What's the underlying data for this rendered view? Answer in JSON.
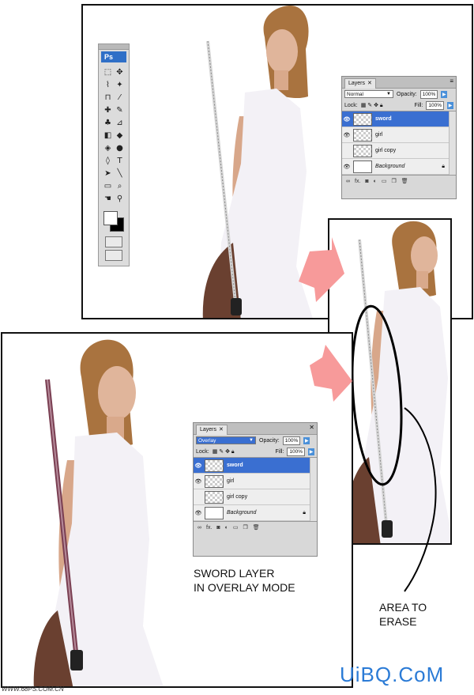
{
  "toolbox": {
    "logo": "Ps",
    "tools": [
      "⬚",
      "✥",
      "⌇",
      "✦",
      "⊓",
      "⁄",
      "✚",
      "✎",
      "♣",
      "⊿",
      "◧",
      "◆",
      "◈",
      "●",
      "◊",
      "T",
      "➤",
      "╲",
      "▭",
      "⌕",
      "☚",
      "⚲"
    ]
  },
  "layers_top": {
    "tab": "Layers",
    "blend_mode": "Normal",
    "opacity_label": "Opacity:",
    "opacity": "100%",
    "lock_label": "Lock:",
    "fill_label": "Fill:",
    "fill": "100%",
    "layers": [
      {
        "name": "sword",
        "selected": true
      },
      {
        "name": "girl",
        "selected": false
      },
      {
        "name": "girl copy",
        "selected": false
      },
      {
        "name": "Background",
        "selected": false
      }
    ]
  },
  "layers_bottom": {
    "tab": "Layers",
    "blend_mode": "Overlay",
    "opacity_label": "Opacity:",
    "opacity": "100%",
    "lock_label": "Lock:",
    "fill_label": "Fill:",
    "fill": "100%",
    "layers": [
      {
        "name": "sword",
        "selected": true
      },
      {
        "name": "girl",
        "selected": false
      },
      {
        "name": "girl copy",
        "selected": false
      },
      {
        "name": "Background",
        "selected": false
      }
    ]
  },
  "captions": {
    "overlay_line1": "SWORD LAYER",
    "overlay_line2": "IN OVERLAY MODE",
    "erase_line1": "AREA TO",
    "erase_line2": "ERASE"
  },
  "watermark": "UiBQ.CoM",
  "site": "WWW.68PS.COM.CN",
  "colors": {
    "arrow": "#f79a9a",
    "selection": "#3a6fd1",
    "watermark": "#2b7bd6"
  }
}
